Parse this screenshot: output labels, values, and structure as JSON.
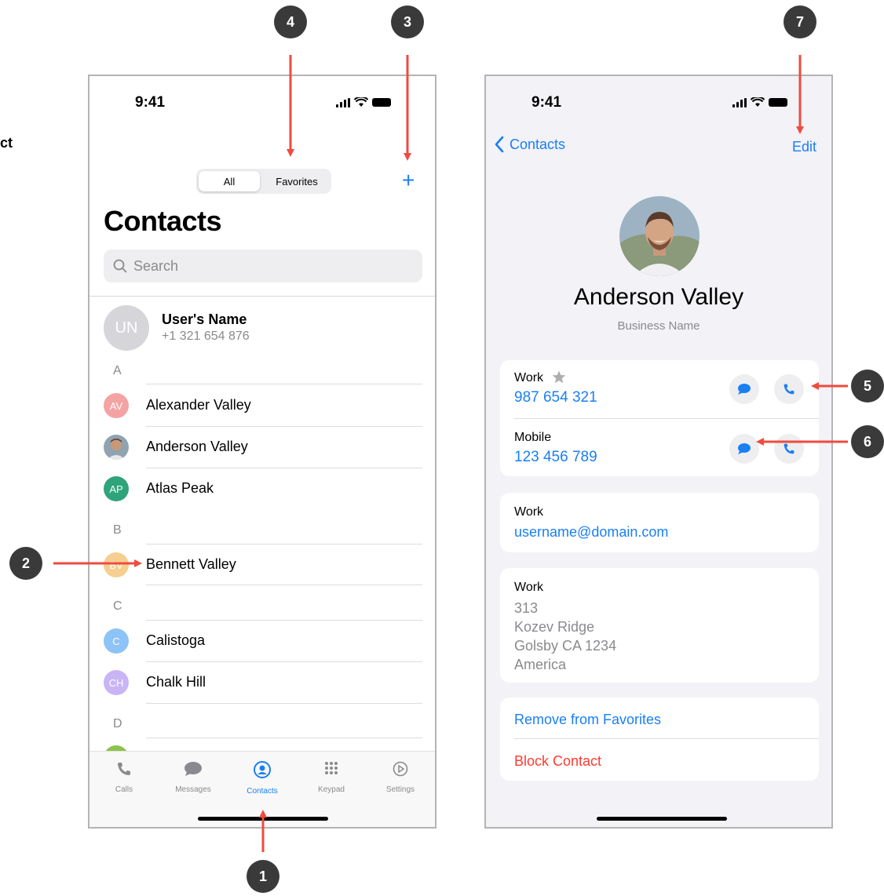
{
  "cut_text": "ct",
  "left_screen": {
    "status_time": "9:41",
    "segment": {
      "all": "All",
      "favorites": "Favorites"
    },
    "add_symbol": "+",
    "title": "Contacts",
    "search_placeholder": "Search",
    "my_card": {
      "initials": "UN",
      "name": "User's Name",
      "phone": "+1 321 654 876"
    },
    "sections": [
      {
        "letter": "A",
        "contacts": [
          {
            "initials": "AV",
            "name": "Alexander Valley",
            "color": "#f4a3a3"
          },
          {
            "initials": "",
            "name": "Anderson Valley",
            "color": "#7b8a8e"
          },
          {
            "initials": "AP",
            "name": "Atlas Peak",
            "color": "#2fa37a"
          }
        ]
      },
      {
        "letter": "B",
        "contacts": [
          {
            "initials": "BV",
            "name": "Bennett Valley",
            "color": "#f6cf90"
          }
        ]
      },
      {
        "letter": "C",
        "contacts": [
          {
            "initials": "C",
            "name": "Calistoga",
            "color": "#8ec3f7"
          },
          {
            "initials": "CH",
            "name": "Chalk Hill",
            "color": "#c9b4f5"
          }
        ]
      },
      {
        "letter": "D",
        "contacts": []
      }
    ],
    "tabs": [
      {
        "label": "Calls",
        "icon": "phone-icon"
      },
      {
        "label": "Messages",
        "icon": "message-bubble-icon"
      },
      {
        "label": "Contacts",
        "icon": "person-circle-icon",
        "active": true
      },
      {
        "label": "Keypad",
        "icon": "keypad-icon"
      },
      {
        "label": "Settings",
        "icon": "settings-icon"
      }
    ]
  },
  "right_screen": {
    "status_time": "9:41",
    "back_label": "Contacts",
    "edit_label": "Edit",
    "name": "Anderson Valley",
    "business": "Business Name",
    "phones": [
      {
        "label": "Work",
        "number": "987 654 321",
        "favorite": true
      },
      {
        "label": "Mobile",
        "number": "123 456 789",
        "favorite": false
      }
    ],
    "email": {
      "label": "Work",
      "value": "username@domain.com"
    },
    "address": {
      "label": "Work",
      "lines": [
        "313",
        "Kozev Ridge",
        "Golsby CA 1234",
        "America"
      ]
    },
    "actions": {
      "remove_favorite": "Remove from Favorites",
      "block": "Block Contact"
    }
  },
  "annotations": [
    "1",
    "2",
    "3",
    "4",
    "5",
    "6",
    "7"
  ],
  "colors": {
    "accent": "#1a7ff5",
    "destructive": "#ff3b30",
    "arrow": "#ef4b3f",
    "badge": "#3a3a3a"
  }
}
